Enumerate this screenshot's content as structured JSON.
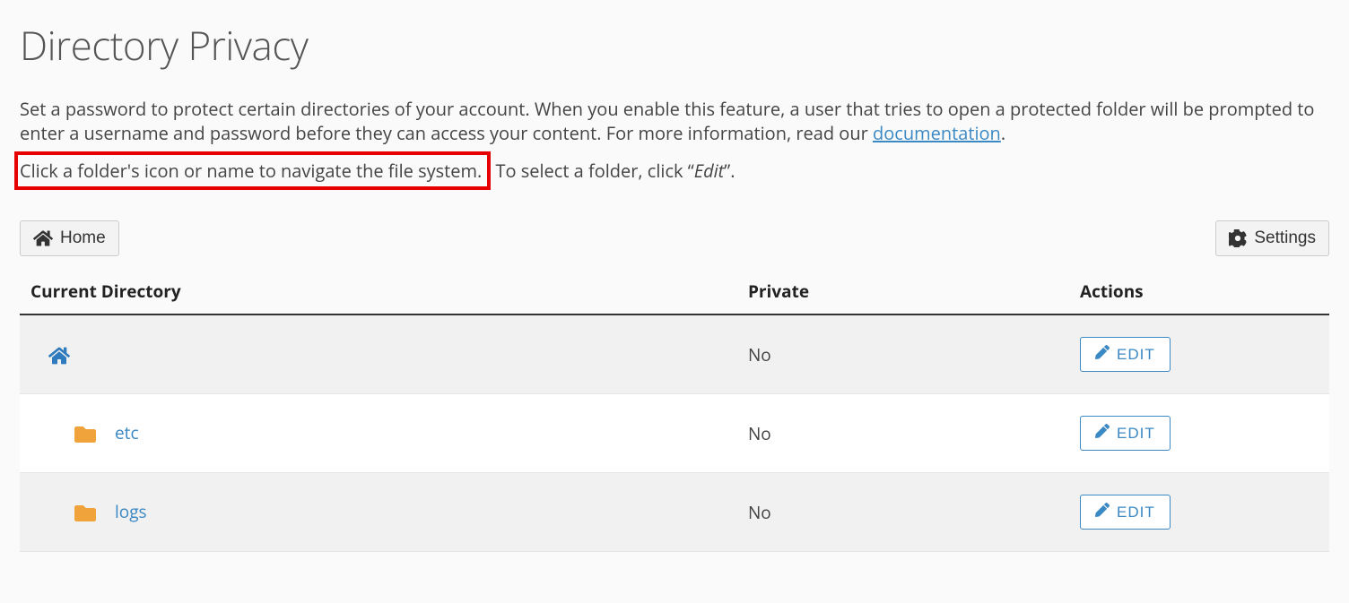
{
  "page": {
    "title": "Directory Privacy",
    "description_part1": "Set a password to protect certain directories of your account. When you enable this feature, a user that tries to open a protected folder will be prompted to enter a username and password before they can access your content. For more information, read our ",
    "doc_link_text": "documentation",
    "description_part2": ".",
    "instruction_highlight": "Click a folder's icon or name to navigate the file system.",
    "instruction_rest_1": " To select a folder, click “",
    "instruction_edit_word": "Edit",
    "instruction_rest_2": "”."
  },
  "toolbar": {
    "home_label": "Home",
    "settings_label": "Settings"
  },
  "table": {
    "headers": {
      "current_directory": "Current Directory",
      "private": "Private",
      "actions": "Actions"
    },
    "rows": [
      {
        "type": "home",
        "name": "",
        "private": "No",
        "edit_label": "EDIT"
      },
      {
        "type": "folder",
        "name": "etc",
        "private": "No",
        "edit_label": "EDIT"
      },
      {
        "type": "folder",
        "name": "logs",
        "private": "No",
        "edit_label": "EDIT"
      }
    ]
  }
}
